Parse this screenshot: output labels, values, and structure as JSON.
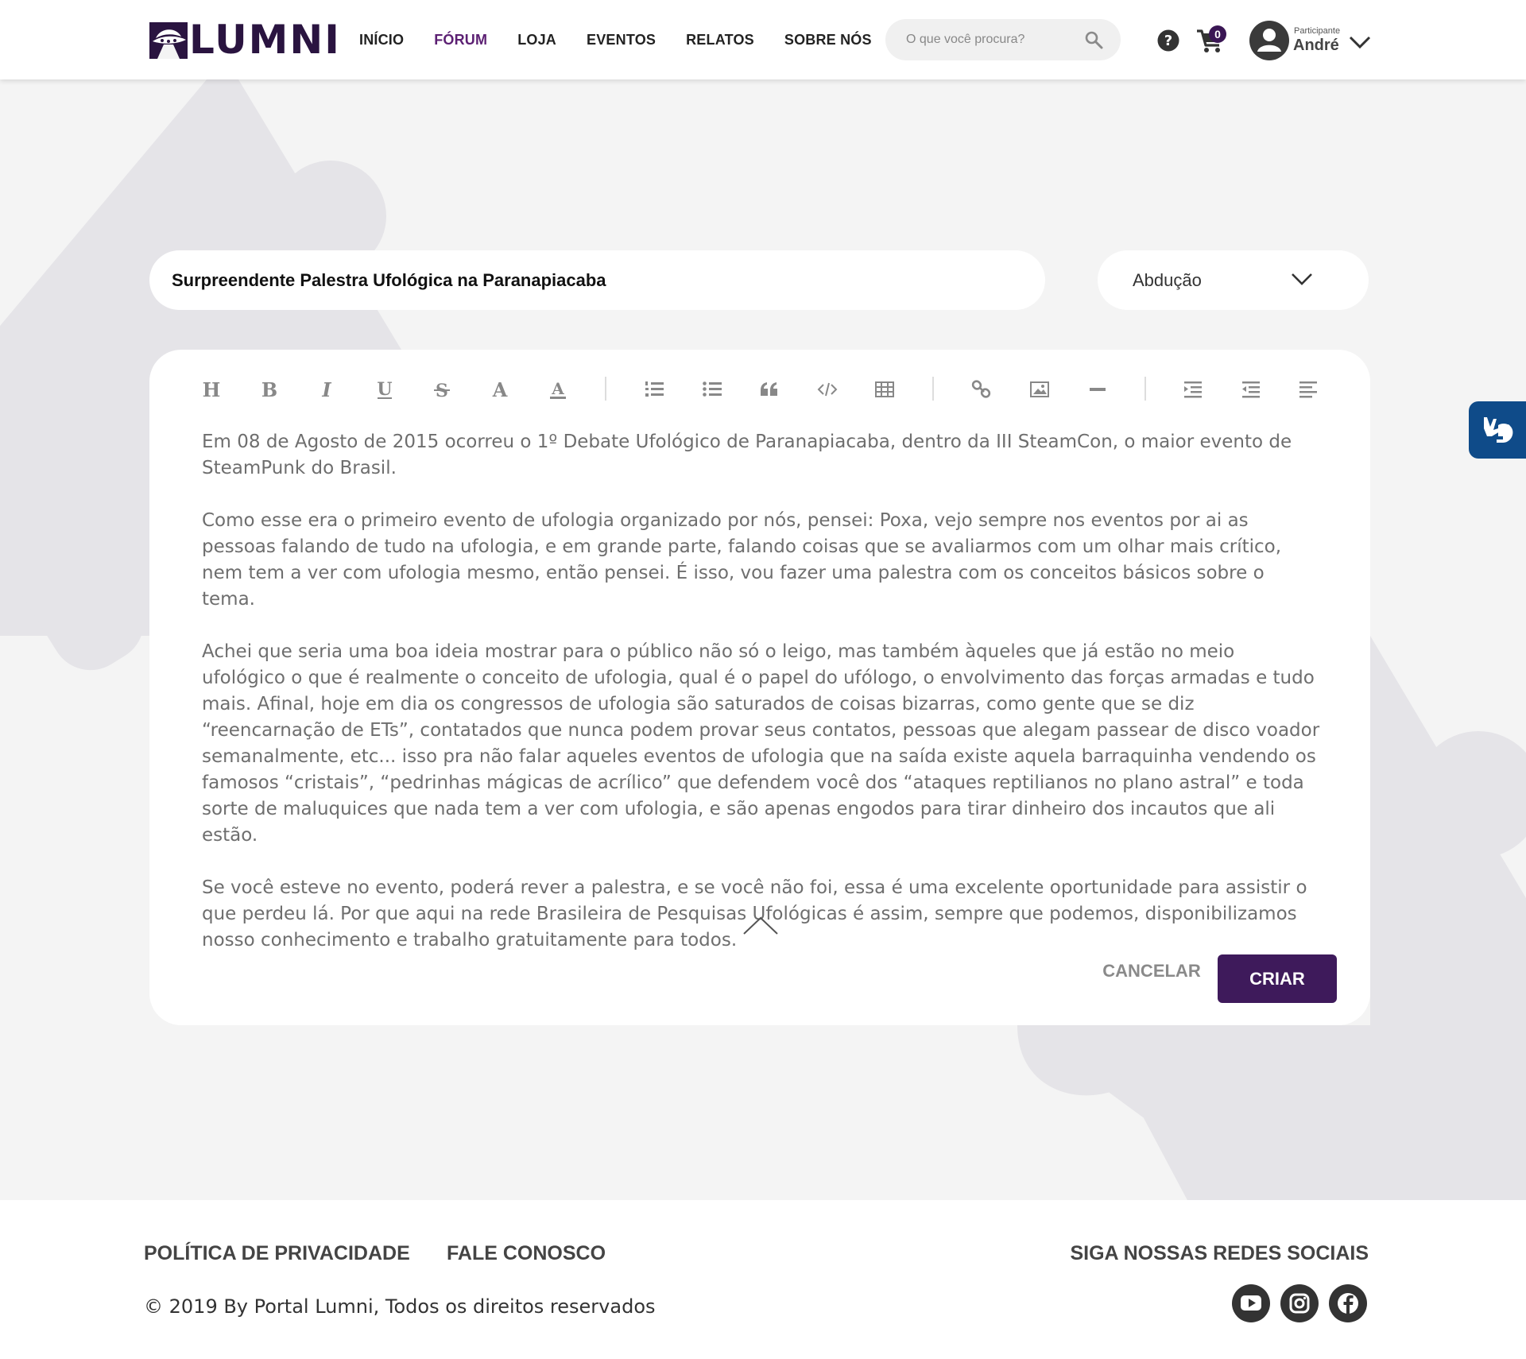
{
  "header": {
    "logo_text": "LUMNI",
    "nav": [
      {
        "label": "INÍCIO",
        "active": false
      },
      {
        "label": "FÓRUM",
        "active": true
      },
      {
        "label": "LOJA",
        "active": false
      },
      {
        "label": "EVENTOS",
        "active": false
      },
      {
        "label": "RELATOS",
        "active": false
      },
      {
        "label": "SOBRE NÓS",
        "active": false
      }
    ],
    "search_placeholder": "O que você procura?",
    "cart_count": "0",
    "user_role": "Participante",
    "user_name": "André"
  },
  "form": {
    "title_value": "Surpreendente Palestra Ufológica na Paranapiacaba",
    "category_value": "Abdução"
  },
  "toolbar": {
    "buttons": [
      "heading-icon",
      "bold-icon",
      "italic-icon",
      "underline-icon",
      "strikethrough-icon",
      "font-color-icon",
      "highlight-icon",
      "ordered-list-icon",
      "unordered-list-icon",
      "quote-icon",
      "code-icon",
      "table-icon",
      "link-icon",
      "image-icon",
      "horizontal-rule-icon",
      "indent-icon",
      "outdent-icon",
      "align-left-icon"
    ]
  },
  "editor": {
    "paragraphs": [
      "Em 08 de Agosto de 2015 ocorreu o 1º Debate Ufológico de Paranapiacaba, dentro da III SteamCon, o maior evento de SteamPunk do Brasil.",
      "Como esse era o primeiro evento de ufologia organizado por nós, pensei: Poxa, vejo sempre nos eventos por ai as pessoas falando de tudo na ufologia, e em grande parte, falando coisas que se avaliarmos com um olhar mais crítico, nem tem a ver com ufologia mesmo, então pensei. É isso, vou fazer uma palestra com os conceitos básicos sobre o tema.",
      "Achei que seria uma boa ideia mostrar para o público não só o leigo, mas também àqueles que já estão no meio ufológico o que é realmente o conceito de ufologia, qual é o papel do ufólogo, o envolvimento das forças armadas e tudo mais. Afinal, hoje em dia os congressos de ufologia são saturados de coisas bizarras, como gente que se diz “reencarnação de ETs”, contatados que nunca podem provar seus contatos, pessoas que alegam passear de disco voador semanalmente, etc... isso pra não falar aqueles eventos de ufologia que na saída existe aquela barraquinha vendendo os famosos “cristais”, “pedrinhas mágicas de acrílico” que defendem você dos “ataques reptilianos no plano astral” e toda sorte de maluquices que nada tem a ver com ufologia, e são apenas engodos para tirar dinheiro dos incautos que ali estão.",
      "Se você esteve no evento, poderá rever a palestra, e se você não foi, essa é uma excelente oportunidade para assistir o que perdeu lá. Por que aqui na rede Brasileira de Pesquisas Ufológicas é assim, sempre que podemos, disponibilizamos nosso conhecimento e trabalho gratuitamente para todos."
    ],
    "cancel_label": "CANCELAR",
    "create_label": "CRIAR"
  },
  "footer": {
    "privacy_label": "POLÍTICA DE PRIVACIDADE",
    "contact_label": "FALE CONOSCO",
    "social_title": "SIGA NOSSAS REDES SOCIAIS",
    "copyright": "© 2019 By Portal Lumni, Todos os direitos reservados",
    "social": [
      "youtube-icon",
      "instagram-icon",
      "facebook-icon"
    ]
  },
  "colors": {
    "accent": "#3e1a5b",
    "active_nav": "#5c2073",
    "background": "#f4f4f4",
    "decoration": "#e4e3e7",
    "a11y_widget": "#0f4b89"
  }
}
